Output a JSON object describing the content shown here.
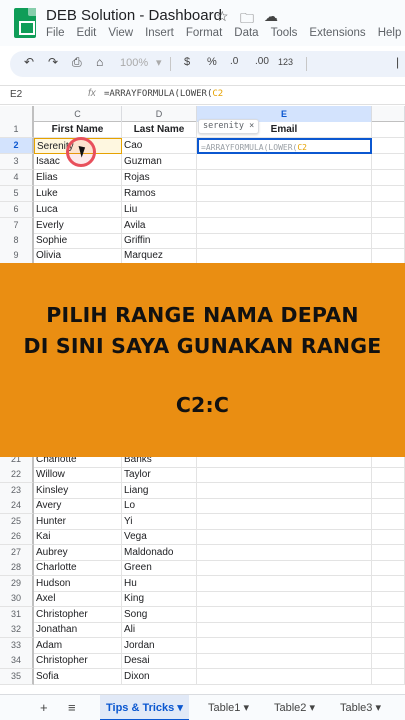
{
  "app": {
    "title": "DEB Solution - Dashboard",
    "menu": [
      "File",
      "Edit",
      "View",
      "Insert",
      "Format",
      "Data",
      "Tools",
      "Extensions",
      "Help"
    ]
  },
  "toolbar": {
    "zoom": "100%",
    "currency": "$",
    "percent": "%",
    "dec_decrease": ".0",
    "dec_increase": ".00",
    "number_format": "123"
  },
  "formula_bar": {
    "cell_ref": "E2",
    "fx": "fx",
    "formula_prefix": "=ARRAYFORMULA(LOWER(",
    "formula_ref": "C2"
  },
  "columns": [
    "C",
    "D",
    "E"
  ],
  "headers": {
    "first_name": "First Name",
    "last_name": "Last Name",
    "email": "Email"
  },
  "chip": {
    "label": "serenity",
    "close": "×"
  },
  "rows_top": [
    {
      "num": "1"
    },
    {
      "num": "2",
      "first": "Serenity",
      "last": "Cao"
    },
    {
      "num": "3",
      "first": "Isaac",
      "last": "Guzman"
    },
    {
      "num": "4",
      "first": "Elias",
      "last": "Rojas"
    },
    {
      "num": "5",
      "first": "Luke",
      "last": "Ramos"
    },
    {
      "num": "6",
      "first": "Luca",
      "last": "Liu"
    },
    {
      "num": "7",
      "first": "Everly",
      "last": "Avila"
    },
    {
      "num": "8",
      "first": "Sophie",
      "last": "Griffin"
    },
    {
      "num": "9",
      "first": "Olivia",
      "last": "Marquez"
    }
  ],
  "rows_bottom": [
    {
      "num": "21",
      "first": "Charlotte",
      "last": "Banks"
    },
    {
      "num": "22",
      "first": "Willow",
      "last": "Taylor"
    },
    {
      "num": "23",
      "first": "Kinsley",
      "last": "Liang"
    },
    {
      "num": "24",
      "first": "Avery",
      "last": "Lo"
    },
    {
      "num": "25",
      "first": "Hunter",
      "last": "Yi"
    },
    {
      "num": "26",
      "first": "Kai",
      "last": "Vega"
    },
    {
      "num": "27",
      "first": "Aubrey",
      "last": "Maldonado"
    },
    {
      "num": "28",
      "first": "Charlotte",
      "last": "Green"
    },
    {
      "num": "29",
      "first": "Hudson",
      "last": "Hu"
    },
    {
      "num": "30",
      "first": "Axel",
      "last": "King"
    },
    {
      "num": "31",
      "first": "Christopher",
      "last": "Song"
    },
    {
      "num": "32",
      "first": "Jonathan",
      "last": "Ali"
    },
    {
      "num": "33",
      "first": "Adam",
      "last": "Jordan"
    },
    {
      "num": "34",
      "first": "Christopher",
      "last": "Desai"
    },
    {
      "num": "35",
      "first": "Sofia",
      "last": "Dixon"
    }
  ],
  "banner": {
    "line1": "PILIH RANGE NAMA DEPAN",
    "line2": "DI SINI SAYA GUNAKAN RANGE",
    "line3": "C2:C"
  },
  "tabs": [
    "Tips & Tricks",
    "Table1",
    "Table2",
    "Table3"
  ],
  "colors": {
    "banner": "#ea8e12",
    "accent": "#0b57d0",
    "ref": "#e6a200",
    "ring": "#e8505b"
  }
}
